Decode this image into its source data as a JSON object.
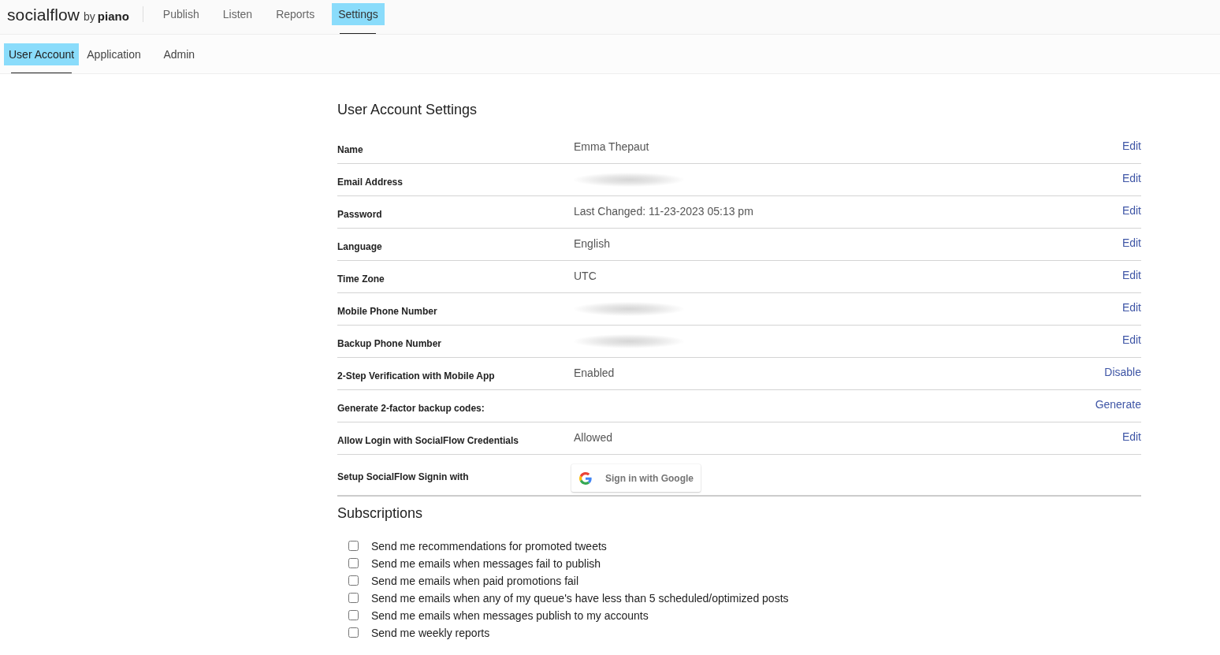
{
  "header": {
    "logo": {
      "wordmark": "socialflow",
      "by": "by",
      "brand": "piano"
    },
    "nav": [
      {
        "label": "Publish",
        "selected": false
      },
      {
        "label": "Listen",
        "selected": false
      },
      {
        "label": "Reports",
        "selected": false
      },
      {
        "label": "Settings",
        "selected": true
      }
    ]
  },
  "subnav": [
    {
      "label": "User Account",
      "selected": true
    },
    {
      "label": "Application",
      "selected": false
    },
    {
      "label": "Admin",
      "selected": false
    }
  ],
  "settings": {
    "title": "User Account Settings",
    "rows": [
      {
        "kind": "text",
        "label": "Name",
        "value": "Emma Thepaut",
        "action": "Edit"
      },
      {
        "kind": "redacted",
        "label": "Email Address",
        "action": "Edit"
      },
      {
        "kind": "text",
        "label": "Password",
        "value": "Last Changed: 11-23-2023 05:13 pm",
        "action": "Edit"
      },
      {
        "kind": "text",
        "label": "Language",
        "value": "English",
        "action": "Edit"
      },
      {
        "kind": "text",
        "label": "Time Zone",
        "value": "UTC",
        "action": "Edit"
      },
      {
        "kind": "redacted",
        "label": "Mobile Phone Number",
        "action": "Edit"
      },
      {
        "kind": "redacted",
        "label": "Backup Phone Number",
        "action": "Edit"
      },
      {
        "kind": "text",
        "label": "2-Step Verification with Mobile App",
        "value": "Enabled",
        "action": "Disable"
      },
      {
        "kind": "blank",
        "label": "Generate 2-factor backup codes:",
        "action": "Generate"
      },
      {
        "kind": "text",
        "label": "Allow Login with SocialFlow Credentials",
        "value": "Allowed",
        "action": "Edit"
      },
      {
        "kind": "signin",
        "label": "Setup SocialFlow Signin with",
        "button": "Sign in with Google"
      }
    ]
  },
  "subscriptions": {
    "title": "Subscriptions",
    "items": [
      {
        "label": "Send me recommendations for promoted tweets",
        "checked": false
      },
      {
        "label": "Send me emails when messages fail to publish",
        "checked": false
      },
      {
        "label": "Send me emails when paid promotions fail",
        "checked": false
      },
      {
        "label": "Send me emails when any of my queue's have less than 5 scheduled/optimized posts",
        "checked": false
      },
      {
        "label": "Send me emails when messages publish to my accounts",
        "checked": false
      },
      {
        "label": "Send me weekly reports",
        "checked": false
      }
    ]
  }
}
